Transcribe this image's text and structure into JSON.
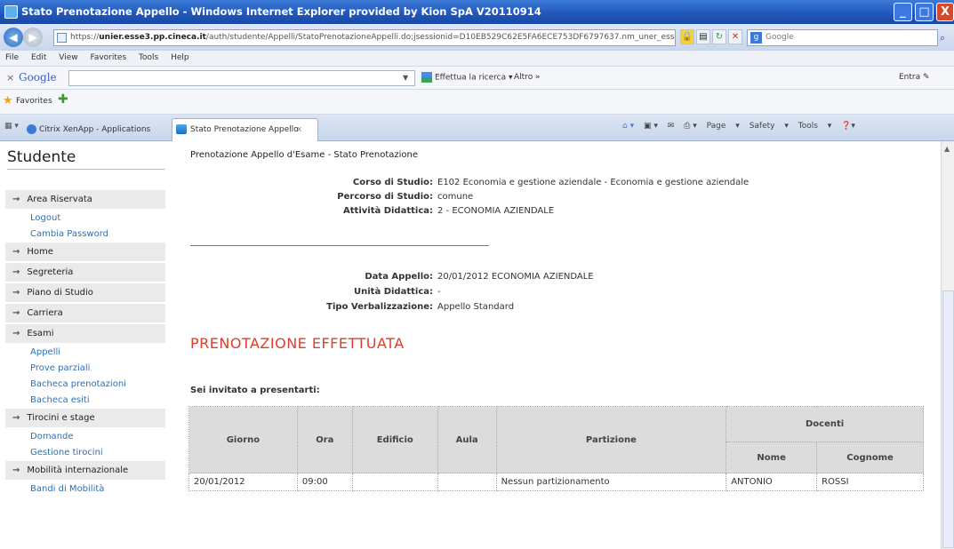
{
  "window": {
    "title": "Stato Prenotazione Appello - Windows Internet Explorer provided by Kion SpA V20110914",
    "min": "_",
    "max": "□",
    "close": "X"
  },
  "address_bar": {
    "url_prefix": "https://",
    "url_host": "unier.esse3.pp.cineca.it",
    "url_rest": "/auth/studente/Appelli/StatoPrenotazioneAppelli.do;jsessionid=D10EB529C62E5FA6ECE753DF6797637.nm_uner_esse",
    "search_placeholder": "Google"
  },
  "menu": [
    "File",
    "Edit",
    "View",
    "Favorites",
    "Tools",
    "Help"
  ],
  "google_toolbar": {
    "close": "×",
    "logo": "Google",
    "search_button": "Effettua la ricerca",
    "more": "Altro »",
    "signin": "Entra"
  },
  "favorites_bar": {
    "label": "Favorites"
  },
  "tabs": [
    {
      "label": "Citrix XenApp - Applications"
    },
    {
      "label": "Stato Prenotazione Appello",
      "close": "x"
    }
  ],
  "command_bar": {
    "page": "Page",
    "safety": "Safety",
    "tools": "Tools"
  },
  "sidebar": {
    "title": "Studente",
    "sections": [
      {
        "label": "Area Riservata",
        "links": [
          "Logout",
          "Cambia Password"
        ]
      },
      {
        "label": "Home",
        "links": []
      },
      {
        "label": "Segreteria",
        "links": []
      },
      {
        "label": "Piano di Studio",
        "links": []
      },
      {
        "label": "Carriera",
        "links": []
      },
      {
        "label": "Esami",
        "links": [
          "Appelli",
          "Prove parziali",
          "Bacheca prenotazioni",
          "Bacheca esiti"
        ]
      },
      {
        "label": "Tirocini e stage",
        "links": [
          "Domande",
          "Gestione tirocini"
        ]
      },
      {
        "label": "Mobilità internazionale",
        "links": [
          "Bandi di Mobilità"
        ]
      }
    ]
  },
  "main": {
    "page_title": "Prenotazione Appello d'Esame - Stato Prenotazione",
    "info1": [
      {
        "label": "Corso di Studio:",
        "value": "E102 Economia e gestione aziendale - Economia e gestione aziendale"
      },
      {
        "label": "Percorso di Studio:",
        "value": "comune"
      },
      {
        "label": "Attività Didattica:",
        "value": "2 - ECONOMIA AZIENDALE"
      }
    ],
    "info2": [
      {
        "label": "Data Appello:",
        "value": "20/01/2012 ECONOMIA AZIENDALE"
      },
      {
        "label": "Unità Didattica:",
        "value": "-"
      },
      {
        "label": "Tipo Verbalizzazione:",
        "value": "Appello Standard"
      }
    ],
    "status_heading": "PRENOTAZIONE EFFETTUATA",
    "invite_label": "Sei invitato a presentarti:",
    "table": {
      "headers": [
        "Giorno",
        "Ora",
        "Edificio",
        "Aula",
        "Partizione",
        "Docenti"
      ],
      "docenti_sub": [
        "Nome",
        "Cognome"
      ],
      "rows": [
        [
          "20/01/2012",
          "09:00",
          "",
          "",
          "Nessun partizionamento",
          "ANTONIO",
          "ROSSI"
        ]
      ]
    }
  }
}
